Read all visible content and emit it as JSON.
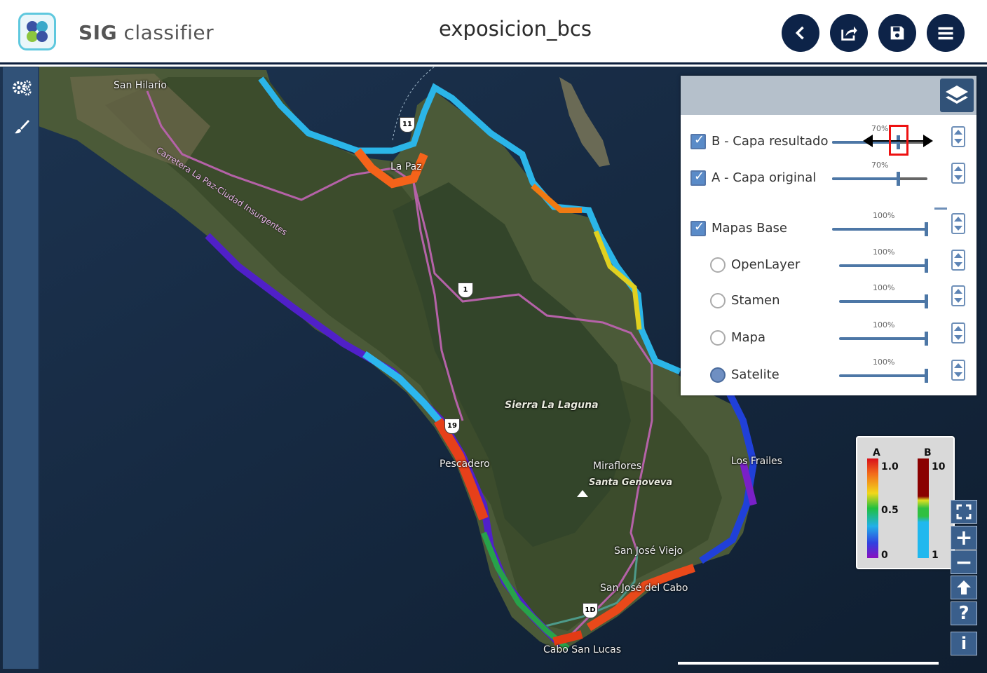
{
  "header": {
    "app_name_bold": "SIG",
    "app_name_rest": "classifier",
    "title": "exposicion_bcs",
    "buttons": [
      {
        "name": "back",
        "icon": "chevron-left-icon"
      },
      {
        "name": "share",
        "icon": "share-icon"
      },
      {
        "name": "save",
        "icon": "floppy-disk-icon"
      },
      {
        "name": "menu",
        "icon": "hamburger-menu-icon"
      }
    ],
    "colors": {
      "button_bg": "#0d2348",
      "logo_border": "#5ec8de"
    }
  },
  "toolbar": {
    "tools": [
      {
        "name": "settings",
        "icon": "gears-icon"
      },
      {
        "name": "style",
        "icon": "paintbrush-icon"
      }
    ]
  },
  "layers_panel": {
    "layers": [
      {
        "label": "B - Capa resultado",
        "checked": true,
        "opacity_label": "70%",
        "opacity": 0.7
      },
      {
        "label": "A - Capa original",
        "checked": true,
        "opacity_label": "70%",
        "opacity": 0.7
      }
    ],
    "base_group": {
      "label": "Mapas Base",
      "checked": true,
      "opacity_label": "100%",
      "opacity": 1.0
    },
    "base_maps": [
      {
        "label": "OpenLayer",
        "selected": false,
        "opacity_label": "100%",
        "opacity": 1.0
      },
      {
        "label": "Stamen",
        "selected": false,
        "opacity_label": "100%",
        "opacity": 1.0
      },
      {
        "label": "Mapa",
        "selected": false,
        "opacity_label": "100%",
        "opacity": 1.0
      },
      {
        "label": "Satelite",
        "selected": true,
        "opacity_label": "100%",
        "opacity": 1.0
      }
    ]
  },
  "legend": {
    "a": {
      "title": "A",
      "max": "1.0",
      "mid": "0.5",
      "min": "0"
    },
    "b": {
      "title": "B",
      "max": "10",
      "min": "1"
    }
  },
  "map_labels": {
    "san_hilario": "San Hilario",
    "road": "Carretera La Paz-Ciudad Insurgentes",
    "la_paz": "La Paz",
    "sierra": "Sierra La Laguna",
    "pescadero": "Pescadero",
    "miraflores": "Miraflores",
    "santa_genoveva": "Santa Genoveva",
    "los_frailes": "Los Frailes",
    "san_jose_viejo": "San José Viejo",
    "san_jose_cabo": "San José del Cabo",
    "cabo": "Cabo San Lucas",
    "hwy1": "1",
    "hwy19": "19",
    "hwy1d": "1D",
    "hwy11": "11"
  },
  "controls": {
    "fullscreen": "fullscreen-icon",
    "zoom_in": "+",
    "zoom_out": "−",
    "north": "arrow-up-icon",
    "help": "?",
    "info": "i"
  }
}
